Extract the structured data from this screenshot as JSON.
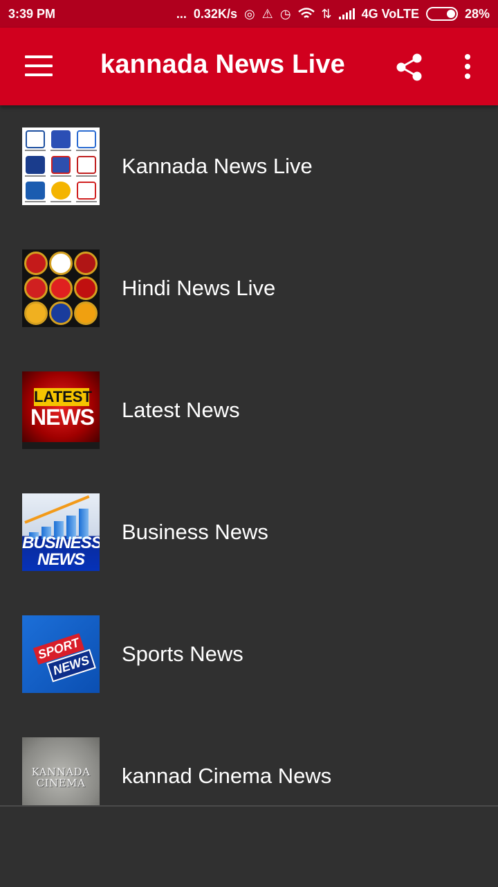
{
  "status_bar": {
    "time": "3:39 PM",
    "dots": "...",
    "speed": "0.32K/s",
    "network": "4G VoLTE",
    "battery": "28%",
    "icons": [
      "hotspot-icon",
      "alarm-off-icon",
      "alarm-icon",
      "wifi-icon",
      "data-arrows-icon",
      "signal-icon",
      "battery-icon"
    ]
  },
  "app_bar": {
    "title": "kannada News Live",
    "color": "#d1001e",
    "icons": [
      "menu-icon",
      "share-icon",
      "more-vert-icon"
    ]
  },
  "list": {
    "items": [
      {
        "label": "Kannada News Live",
        "thumbnail": "kannada-channels-thumbnail"
      },
      {
        "label": "Hindi News Live",
        "thumbnail": "hindi-channels-thumbnail"
      },
      {
        "label": "Latest News",
        "thumbnail": "latest-news-thumbnail",
        "thumb_text": [
          "LATEST",
          "NEWS"
        ]
      },
      {
        "label": "Business News",
        "thumbnail": "business-news-thumbnail",
        "thumb_text": [
          "BUSINESS",
          "NEWS"
        ]
      },
      {
        "label": "Sports News",
        "thumbnail": "sports-news-thumbnail",
        "thumb_text": [
          "SPORT",
          "NEWS"
        ]
      },
      {
        "label": "kannad Cinema News",
        "thumbnail": "kannada-cinema-thumbnail",
        "thumb_text": [
          "KANNADA",
          "CINEMA"
        ]
      }
    ]
  },
  "colors": {
    "background": "#303030",
    "status_bar": "#b0001e",
    "text": "#ffffff"
  }
}
